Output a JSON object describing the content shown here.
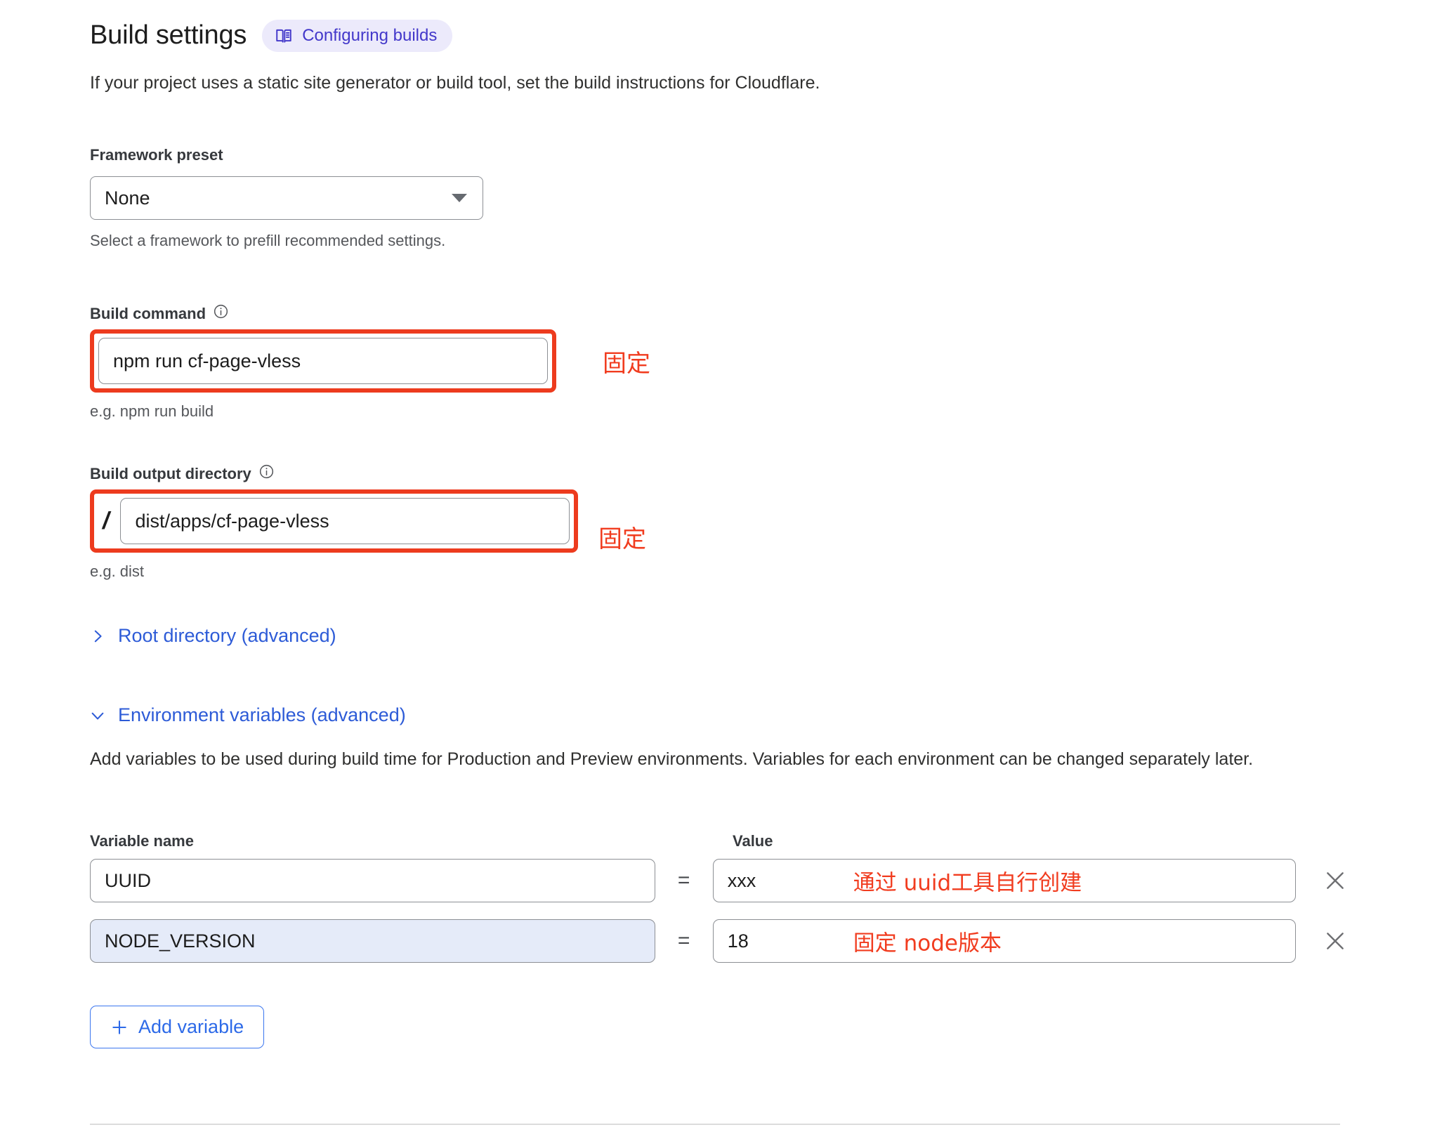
{
  "header": {
    "title": "Build settings",
    "badge_label": "Configuring builds",
    "badge_icon": "book-icon",
    "intro": "If your project uses a static site generator or build tool, set the build instructions for Cloudflare."
  },
  "framework_preset": {
    "label": "Framework preset",
    "value": "None",
    "helper": "Select a framework to prefill recommended settings.",
    "caret_icon": "chevron-down-icon"
  },
  "build_command": {
    "label": "Build command",
    "info_icon": "info-icon",
    "value": "npm run cf-page-vless",
    "helper": "e.g. npm run build",
    "annotation": "固定"
  },
  "build_output_directory": {
    "label": "Build output directory",
    "info_icon": "info-icon",
    "prefix": "/",
    "value": "dist/apps/cf-page-vless",
    "helper": "e.g. dist",
    "annotation": "固定"
  },
  "root_directory": {
    "label": "Root directory (advanced)",
    "chevron_icon": "chevron-right-icon"
  },
  "environment_variables": {
    "label": "Environment variables (advanced)",
    "chevron_icon": "chevron-down-icon",
    "description": "Add variables to be used during build time for Production and Preview environments. Variables for each environment can be changed separately later.",
    "columns": {
      "name": "Variable name",
      "value": "Value"
    },
    "equals": "=",
    "rows": [
      {
        "name": "UUID",
        "value": "xxx",
        "note": "通过 uuid工具自行创建",
        "highlighted": false,
        "delete_icon": "close-icon"
      },
      {
        "name": "NODE_VERSION",
        "value": "18",
        "note": "固定 node版本",
        "highlighted": true,
        "delete_icon": "close-icon"
      }
    ],
    "add_button": {
      "label": "Add variable",
      "icon": "plus-icon"
    }
  },
  "colors": {
    "accent_blue": "#2d5bd7",
    "badge_purple": "#4338ca",
    "badge_bg": "#eceafb",
    "annotation_red": "#f13c1f",
    "highlight_box_red": "#ed3b1e",
    "field_highlight_bg": "#e5ebf9"
  }
}
